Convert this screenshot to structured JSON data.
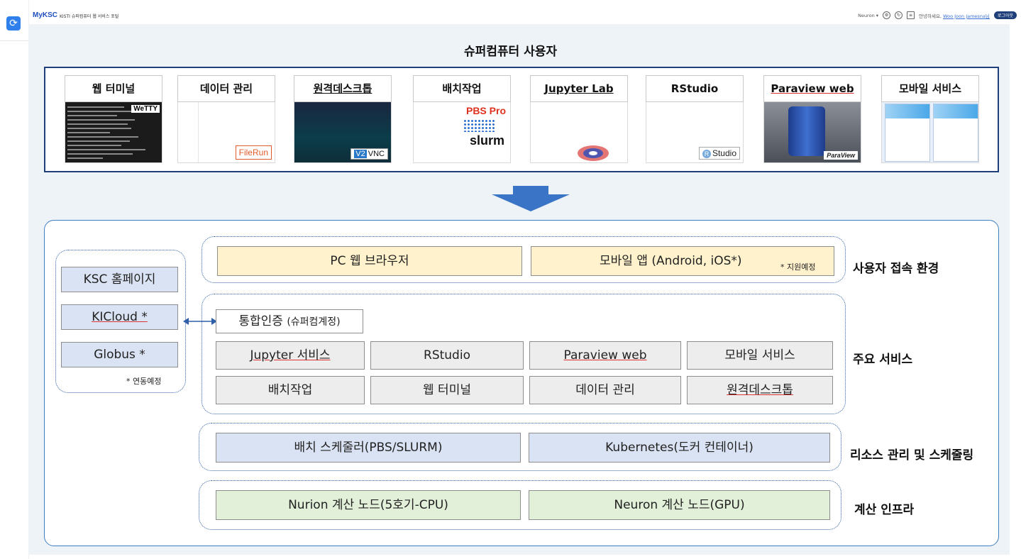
{
  "topbar": {
    "brand": "MyKSC",
    "brand_sub": "KISTI 슈퍼컴퓨터 웹 서비스 포털",
    "system_select": "Neuron",
    "greeting_prefix": "안녕하세요,",
    "user_name": "Woo Joon Jamesna님",
    "logout": "로그아웃"
  },
  "diagram": {
    "title": "슈퍼컴퓨터 사용자",
    "cards": [
      {
        "label": "웹 터미널",
        "badge": "WeTTY"
      },
      {
        "label": "데이터 관리",
        "badge": "FileRun"
      },
      {
        "label": "원격데스크톱",
        "badge": "VNC",
        "badge_prefix": "V2"
      },
      {
        "label": "배치작업",
        "badge": "PBS Pro",
        "badge2": "slurm"
      },
      {
        "label": "Jupyter Lab"
      },
      {
        "label": "RStudio",
        "badge": "Studio",
        "badge_prefix": "R"
      },
      {
        "label": "Paraview web",
        "badge": "ParaView"
      },
      {
        "label": "모바일 서비스"
      }
    ],
    "access": {
      "pc": "PC 웹 브라우저",
      "mobile": "모바일 앱 (Android, iOS*)",
      "mobile_note": "* 지원예정",
      "label": "사용자 접속 환경"
    },
    "external": {
      "items": [
        "KSC 홈페이지",
        "KICloud *",
        "Globus *"
      ],
      "note": "* 연동예정"
    },
    "services": {
      "auth": "통합인증",
      "auth_sub": "(슈퍼컴계정)",
      "row1": [
        "Jupyter 서비스",
        "RStudio",
        "Paraview web",
        "모바일 서비스"
      ],
      "row2": [
        "배치작업",
        "웹 터미널",
        "데이터 관리",
        "원격데스크톱"
      ],
      "label": "주요 서비스"
    },
    "resources": {
      "batch": "배치 스케줄러(PBS/SLURM)",
      "k8s": "Kubernetes(도커 컨테이너)",
      "label": "리소스 관리 및 스케줄링"
    },
    "compute": {
      "nurion": "Nurion 계산 노드(5호기-CPU)",
      "neuron": "Neuron 계산 노드(GPU)",
      "label": "계산 인프라"
    },
    "colors": {
      "frame": "#1f3f7a",
      "arrow": "#3a74c6",
      "yellow": "#fff2cc",
      "grey": "#ededed",
      "blue": "#dae3f3",
      "green": "#e2efd9"
    }
  }
}
